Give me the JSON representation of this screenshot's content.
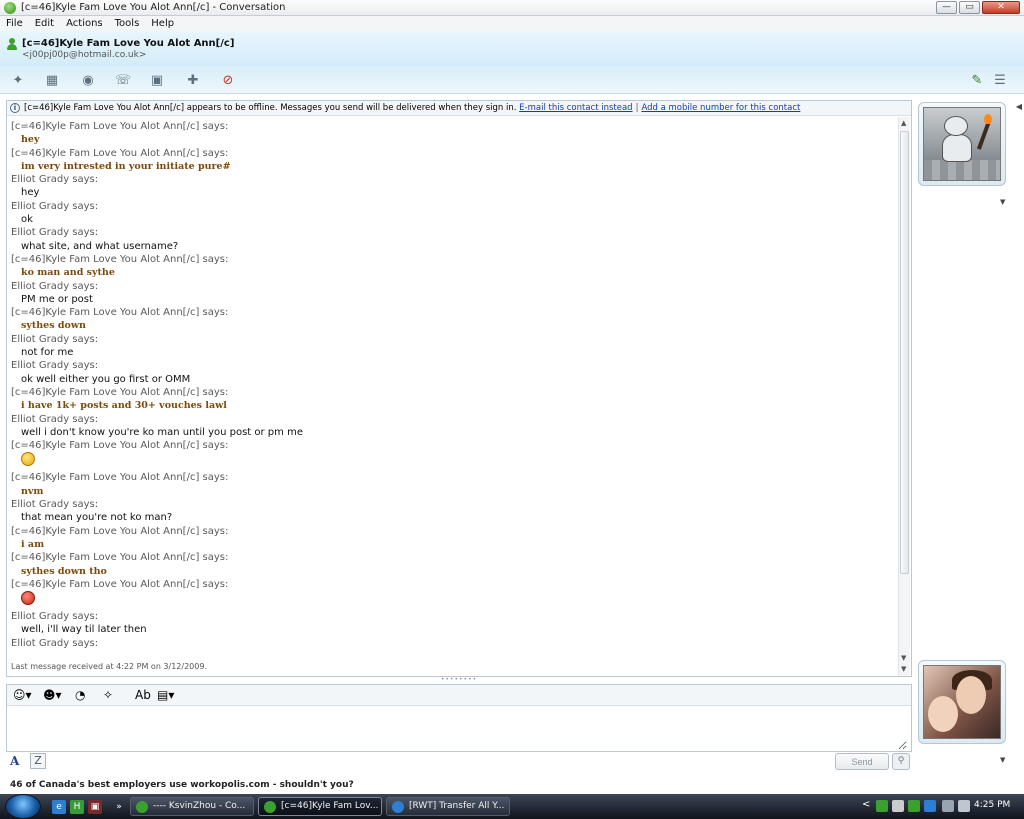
{
  "window": {
    "title": "[c=46]Kyle Fam Love You Alot Ann[/c] - Conversation",
    "minimize": "—",
    "maximize": "▭",
    "close": "✕"
  },
  "menu": [
    "File",
    "Edit",
    "Actions",
    "Tools",
    "Help"
  ],
  "contact": {
    "name": "[c=46]Kyle Fam Love You Alot Ann[/c]",
    "email": "<j00pj00p@hotmail.co.uk>"
  },
  "toolbar_icons": [
    "invite-icon",
    "share-files-icon",
    "video-call-icon",
    "call-icon",
    "games-icon",
    "activities-icon",
    "block-icon",
    "paintbrush-icon",
    "menu-icon"
  ],
  "info_bar": {
    "text": "[c=46]Kyle Fam Love You Alot Ann[/c] appears to be offline. Messages you send will be delivered when they sign in.",
    "email_link": "E-mail this contact instead",
    "mobile_link": "Add a mobile number for this contact"
  },
  "messages": [
    {
      "sender": "[c=46]Kyle Fam Love You Alot Ann[/c] says:",
      "text": "hey",
      "style": "kyle"
    },
    {
      "sender": "[c=46]Kyle Fam Love You Alot Ann[/c] says:",
      "text": "im very intrested in your initiate pure#",
      "style": "kyle"
    },
    {
      "sender": "Elliot Grady says:",
      "text": "hey",
      "style": "elliot"
    },
    {
      "sender": "Elliot Grady says:",
      "text": "ok",
      "style": "elliot"
    },
    {
      "sender": "Elliot Grady says:",
      "text": "what site, and what username?",
      "style": "elliot"
    },
    {
      "sender": "[c=46]Kyle Fam Love You Alot Ann[/c] says:",
      "text": "ko man and sythe",
      "style": "kyle"
    },
    {
      "sender": "Elliot Grady says:",
      "text": "PM me or post",
      "style": "elliot"
    },
    {
      "sender": "[c=46]Kyle Fam Love You Alot Ann[/c] says:",
      "text": "sythes down",
      "style": "kyle"
    },
    {
      "sender": "Elliot Grady says:",
      "text": "not for me",
      "style": "elliot"
    },
    {
      "sender": "Elliot Grady says:",
      "text": "ok well either you go first or OMM",
      "style": "elliot"
    },
    {
      "sender": "[c=46]Kyle Fam Love You Alot Ann[/c] says:",
      "text": "i have 1k+ posts and 30+ vouches lawl",
      "style": "kyle"
    },
    {
      "sender": "Elliot Grady says:",
      "text": "well i don't know you're ko man until you post or pm me",
      "style": "elliot"
    },
    {
      "sender": "[c=46]Kyle Fam Love You Alot Ann[/c] says:",
      "emoticon": "confused",
      "style": "kyle"
    },
    {
      "sender": "[c=46]Kyle Fam Love You Alot Ann[/c] says:",
      "text": "nvm",
      "style": "kyle"
    },
    {
      "sender": "Elliot Grady says:",
      "text": "that mean you're not ko man?",
      "style": "elliot"
    },
    {
      "sender": "[c=46]Kyle Fam Love You Alot Ann[/c] says:",
      "text": "i am",
      "style": "kyle"
    },
    {
      "sender": "[c=46]Kyle Fam Love You Alot Ann[/c] says:",
      "text": "sythes down tho",
      "style": "kyle"
    },
    {
      "sender": "[c=46]Kyle Fam Love You Alot Ann[/c] says:",
      "emoticon": "angry",
      "style": "kyle"
    },
    {
      "sender": "Elliot Grady says:",
      "text": "well, i'll way til later then",
      "style": "elliot"
    },
    {
      "sender": "Elliot Grady says:",
      "text": "",
      "style": "elliot"
    }
  ],
  "last_message": "Last message received at 4:22 PM on 3/12/2009.",
  "compose": {
    "placeholder": "",
    "send_label": "Send",
    "font_label": "A",
    "handwrite_label": "Z"
  },
  "ad": "46 of Canada's best employers use workopolis.com - shouldn't you?",
  "taskbar": {
    "items": [
      {
        "label": "---- KsvinZhou - Co...",
        "active": false
      },
      {
        "label": "[c=46]Kyle Fam Lov...",
        "active": true
      },
      {
        "label": "[RWT] Transfer All Y...",
        "active": false
      }
    ],
    "overflow": "»",
    "tray_arrow": "<",
    "clock": "4:25 PM"
  },
  "colors": {
    "kyle_text": "#7a4a0c",
    "link": "#0645ad",
    "header_bg": "#d2ecf8",
    "online_green": "#3aa02e"
  }
}
